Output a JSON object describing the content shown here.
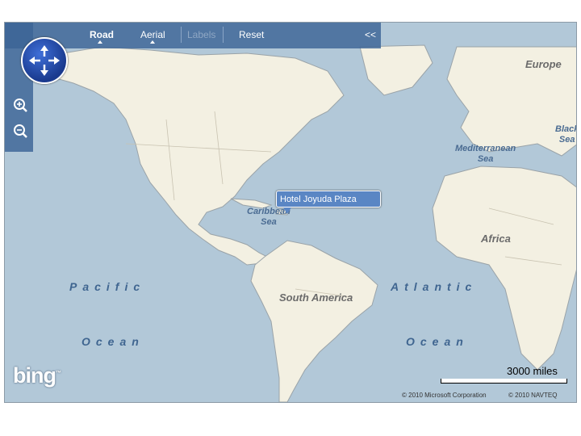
{
  "toolbar": {
    "tabs": [
      {
        "label": "Road",
        "state": "active"
      },
      {
        "label": "Aerial",
        "state": "normal"
      },
      {
        "label": "Labels",
        "state": "disabled"
      },
      {
        "label": "Reset",
        "state": "normal"
      }
    ],
    "collapse_label": "<<"
  },
  "controls": {
    "compass_icon": "pan-compass-icon",
    "zoom_in_icon": "zoom-in-icon",
    "zoom_out_icon": "zoom-out-icon"
  },
  "pushpin": {
    "label": "Hotel Joyuda Plaza"
  },
  "map_labels": {
    "europe": "Europe",
    "black_sea_1": "Black",
    "black_sea_2": "Sea",
    "mediterranean_1": "Mediterranean",
    "mediterranean_2": "Sea",
    "caribbean_1": "Caribbean",
    "caribbean_2": "Sea",
    "africa": "Africa",
    "south_america": "South America",
    "pacific": "Pacific",
    "pacific_ocean": "Ocean",
    "atlantic": "Atlantic",
    "atlantic_ocean": "Ocean"
  },
  "scale": {
    "label": "3000 miles"
  },
  "footer": {
    "logo": "bing",
    "trademark": "™",
    "copyright_ms": "© 2010 Microsoft Corporation",
    "copyright_navteq": "© 2010 NAVTEQ"
  },
  "colors": {
    "water": "#b2c8d8",
    "land": "#f3f0e2",
    "toolbar": "#3c6496",
    "pin": "#5a86c4"
  }
}
